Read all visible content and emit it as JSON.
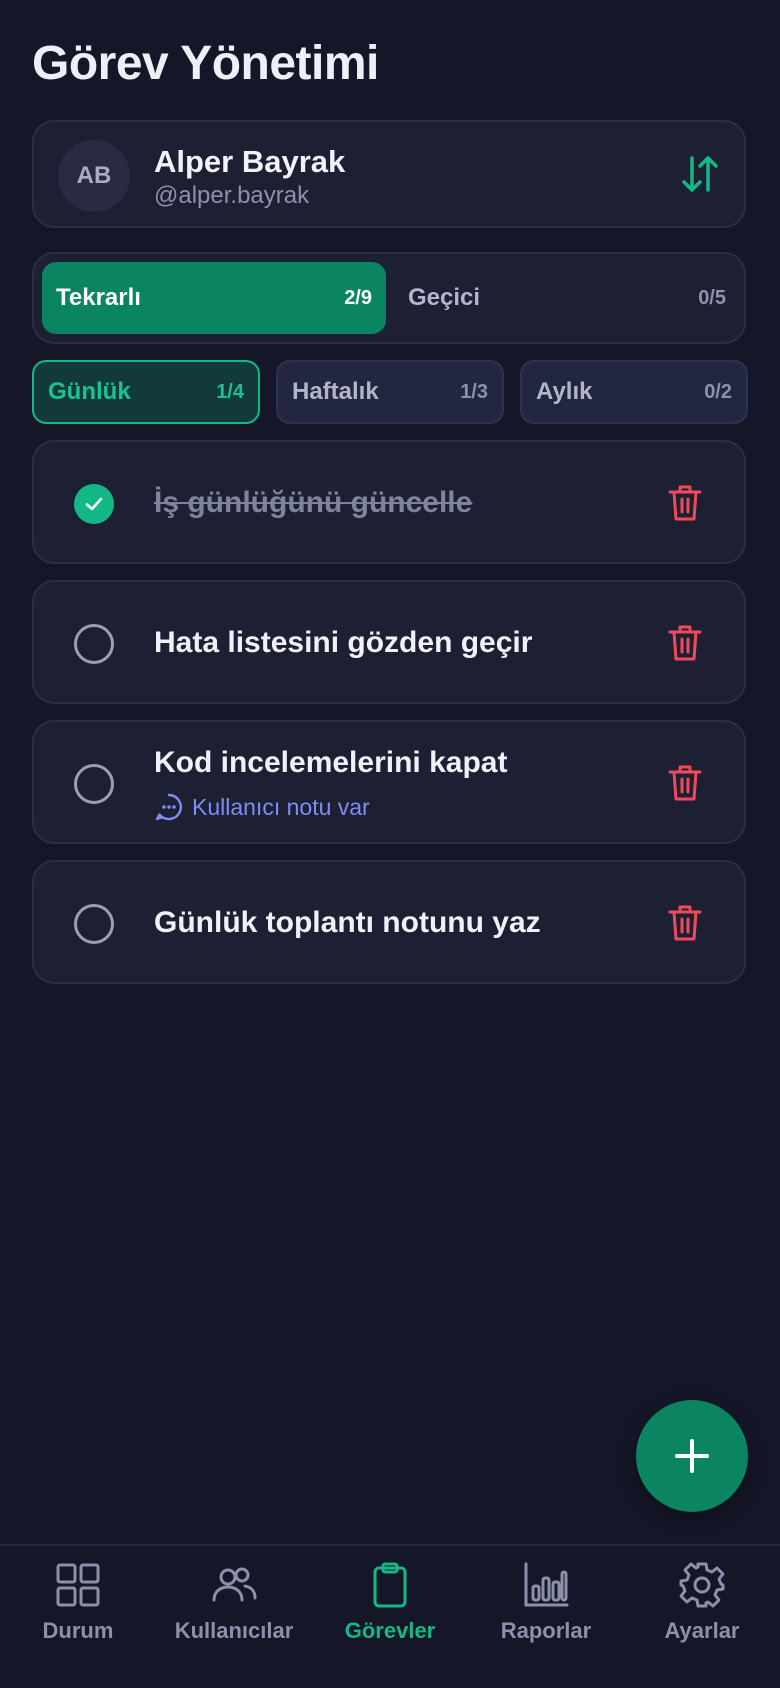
{
  "page": {
    "title": "Görev Yönetimi"
  },
  "user": {
    "initials": "AB",
    "name": "Alper Bayrak",
    "handle": "@alper.bayrak",
    "switch_icon": "sort-arrows-icon"
  },
  "segments": [
    {
      "label": "Tekrarlı",
      "count": "2/9",
      "active": true
    },
    {
      "label": "Geçici",
      "count": "0/5",
      "active": false
    }
  ],
  "periods": [
    {
      "label": "Günlük",
      "count": "1/4",
      "active": true
    },
    {
      "label": "Haftalık",
      "count": "1/3",
      "active": false
    },
    {
      "label": "Aylık",
      "count": "0/2",
      "active": false
    }
  ],
  "tasks": [
    {
      "title": "İş günlüğünü güncelle",
      "done": true
    },
    {
      "title": "Hata listesini gözden geçir",
      "done": false
    },
    {
      "title": "Kod incelemelerini kapat",
      "done": false,
      "note": "Kullanıcı notu var"
    },
    {
      "title": "Günlük toplantı notunu yaz",
      "done": false
    }
  ],
  "fab": {
    "icon": "plus-icon"
  },
  "nav": [
    {
      "label": "Durum",
      "icon": "grid-icon",
      "active": false
    },
    {
      "label": "Kullanıcılar",
      "icon": "users-icon",
      "active": false
    },
    {
      "label": "Görevler",
      "icon": "clipboard-icon",
      "active": true
    },
    {
      "label": "Raporlar",
      "icon": "bar-chart-icon",
      "active": false
    },
    {
      "label": "Ayarlar",
      "icon": "gear-icon",
      "active": false
    }
  ],
  "colors": {
    "background": "#151728",
    "card": "#1D1F33",
    "accent": "#0A8461",
    "accent_text": "#12B886",
    "danger": "#EF4A5A",
    "note": "#7C8DF5"
  }
}
